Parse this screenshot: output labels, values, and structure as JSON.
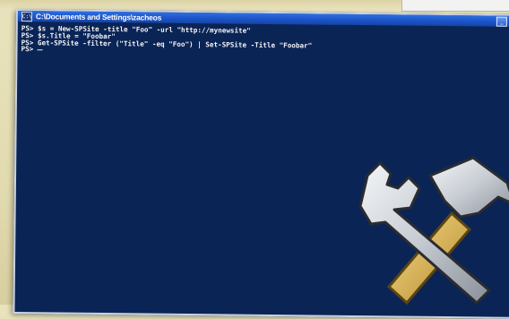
{
  "window": {
    "title": "C:\\Documents and Settings\\zacheos",
    "icon_label": "C:\\",
    "minimize_glyph": "_"
  },
  "console": {
    "lines": [
      "PS> $s = New-SPSite -title \"Foo\" -url \"http://mynewsite\"",
      "PS> $s.Title = \"Foobar\"",
      "PS> Get-SPSite -filter (\"Title\" -eq \"Foo\") | Set-SPSite -Title \"Foobar\"",
      "PS> "
    ]
  },
  "colors": {
    "console_bg": "#0a2456",
    "console_text": "#f4f4f4",
    "titlebar": "#1b54c8",
    "desktop_bg": "#e2dbb0"
  },
  "icons": {
    "overlay": "wrench-hammer-tools-icon"
  }
}
